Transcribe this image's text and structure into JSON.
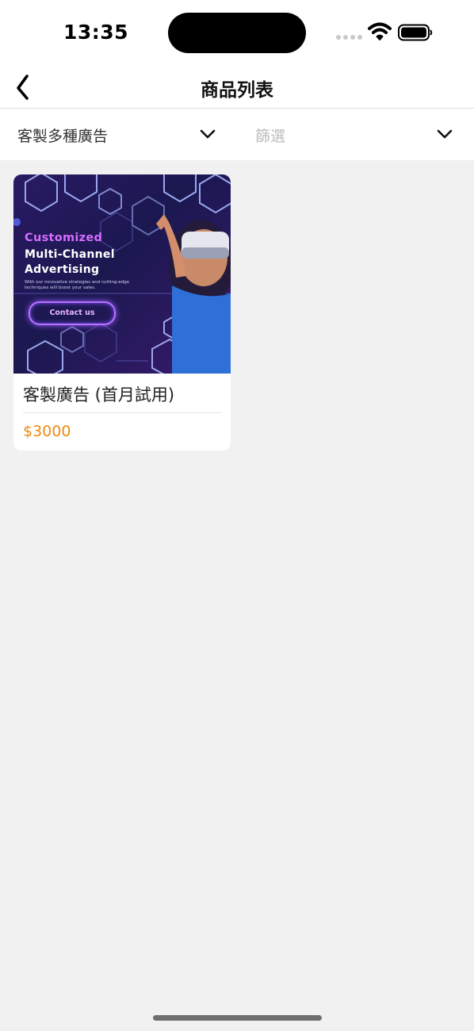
{
  "status_bar": {
    "time": "13:35"
  },
  "nav": {
    "title": "商品列表",
    "back_icon": "chevron-left-icon"
  },
  "filters": {
    "category": {
      "value": "客製多種廣告",
      "icon": "chevron-down-icon"
    },
    "filter": {
      "placeholder": "篩選",
      "icon": "chevron-down-icon"
    }
  },
  "products": [
    {
      "name": "客製廣告 (首月試用)",
      "price": "$3000",
      "image": {
        "headline_1": "Customized",
        "headline_2": "Multi-Channel",
        "headline_3": "Advertising",
        "subtext": "With our innovative strategies and cutting-edge techniques will boost your sales.",
        "cta": "Contact us"
      }
    }
  ],
  "colors": {
    "price": "#f08a10",
    "background": "#f1f1f1",
    "card": "#ffffff",
    "ad_accent": "#d56cff"
  }
}
